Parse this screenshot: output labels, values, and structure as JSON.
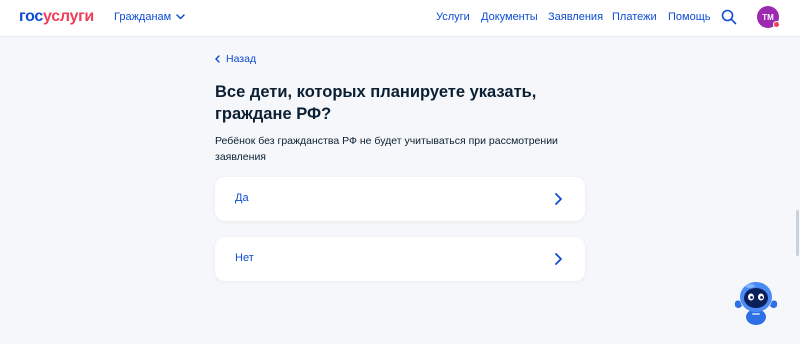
{
  "header": {
    "logo_part1": "гос",
    "logo_part2": "услуги",
    "audience": "Гражданам",
    "nav": [
      "Услуги",
      "Документы",
      "Заявления",
      "Платежи",
      "Помощь"
    ],
    "avatar_initials": "ТМ",
    "colors": {
      "brand_blue": "#0d4cd3",
      "brand_red": "#ee3f58",
      "avatar": "#9c29b0"
    }
  },
  "main": {
    "back_label": "Назад",
    "title": "Все дети, которых планируете указать, граждане РФ?",
    "subtitle": "Ребёнок без гражданства РФ не будет учитываться при рассмотрении заявления",
    "options": [
      "Да",
      "Нет"
    ]
  },
  "icons": {
    "audience_chevron": "chevron-down-icon",
    "search": "search-icon",
    "back": "chevron-left-icon",
    "option_arrow": "chevron-right-icon",
    "assistant": "robot-assistant-icon"
  }
}
